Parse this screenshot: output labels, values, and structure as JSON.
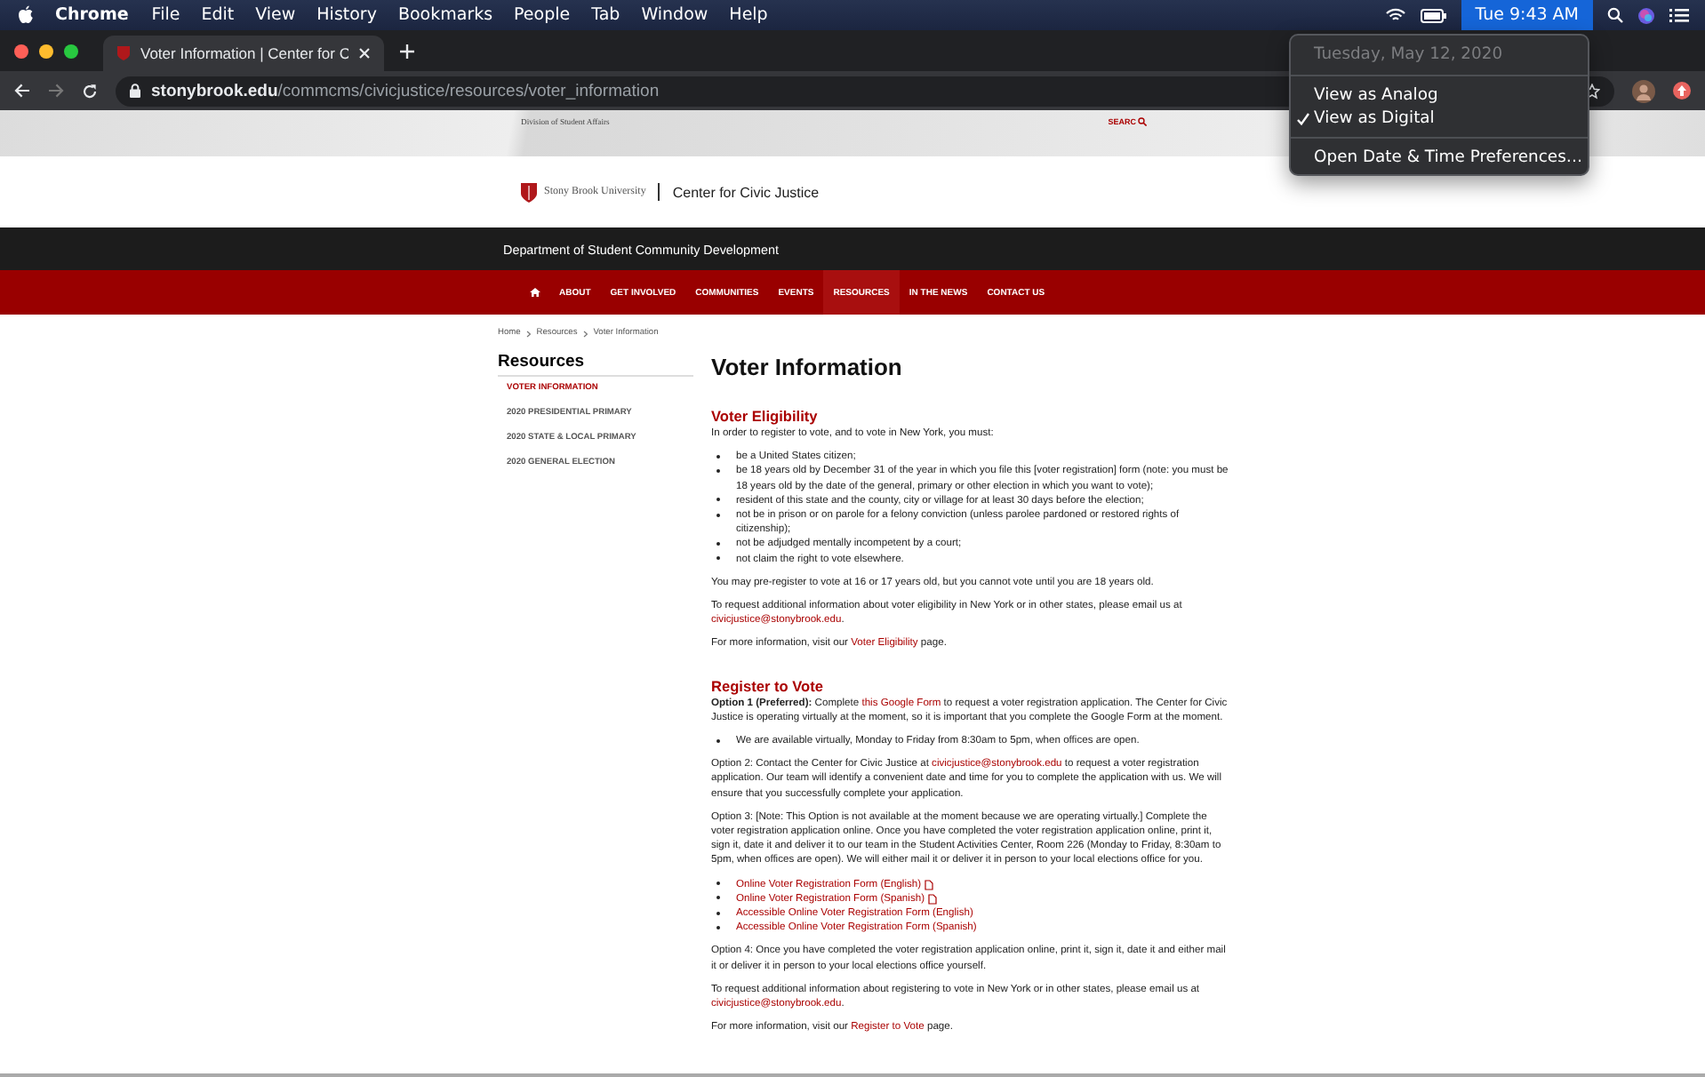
{
  "menu_bar": {
    "app": "Chrome",
    "menus": [
      "File",
      "Edit",
      "View",
      "History",
      "Bookmarks",
      "People",
      "Tab",
      "Window",
      "Help"
    ],
    "clock": {
      "text": "Tue 9:43 AM",
      "highlighted": true
    }
  },
  "clock_menu": [
    {
      "kind": "header",
      "text": "Tuesday, May 12, 2020",
      "disabled": true
    },
    {
      "kind": "separator"
    },
    {
      "kind": "item",
      "text": "View as Analog",
      "checked": false
    },
    {
      "kind": "item",
      "text": "View as Digital",
      "checked": true
    },
    {
      "kind": "separator"
    },
    {
      "kind": "item",
      "text": "Open Date & Time Preferences…",
      "checked": false
    }
  ],
  "browser": {
    "tab_title": "Voter Information | Center for C",
    "url_host": "stonybrook.edu",
    "url_path": "/commcms/civicjustice/resources/voter_information"
  },
  "site": {
    "top_strip": "Division of Student Affairs",
    "search": "SEARC",
    "university": "Stony Brook University",
    "center": "Center for Civic Justice",
    "department": "Department of Student Community Development",
    "nav": [
      {
        "label": "ABOUT",
        "selected": false
      },
      {
        "label": "GET INVOLVED",
        "selected": false
      },
      {
        "label": "COMMUNITIES",
        "selected": false
      },
      {
        "label": "EVENTS",
        "selected": false
      },
      {
        "label": "RESOURCES",
        "selected": true
      },
      {
        "label": "IN THE NEWS",
        "selected": false
      },
      {
        "label": "CONTACT US",
        "selected": false
      }
    ],
    "breadcrumb": [
      "Home",
      "Resources",
      "Voter Information"
    ]
  },
  "sidebar": {
    "title": "Resources",
    "items": [
      {
        "label": "VOTER INFORMATION",
        "selected": true
      },
      {
        "label": "2020 PRESIDENTIAL PRIMARY",
        "selected": false
      },
      {
        "label": "2020 STATE & LOCAL PRIMARY",
        "selected": false
      },
      {
        "label": "2020 GENERAL ELECTION",
        "selected": false
      }
    ]
  },
  "page_title": "Voter Information",
  "sections": [
    {
      "heading": "Voter Eligibility",
      "blocks": [
        {
          "kind": "p",
          "parts": [
            {
              "kind": "text",
              "text": "In order to register to vote, and to vote in New York, you must:"
            }
          ]
        },
        {
          "kind": "ul",
          "items": [
            {
              "parts": [
                {
                  "kind": "text",
                  "text": "be a United States citizen;"
                }
              ]
            },
            {
              "parts": [
                {
                  "kind": "text",
                  "text": "be 18 years old by December 31 of the year in which you file this [voter registration] form (note: you must be 18 years old by the date of the general, primary or other election in which you want to vote);"
                }
              ]
            },
            {
              "parts": [
                {
                  "kind": "text",
                  "text": "resident of this state and the county, city or village for at least 30 days before the election;"
                }
              ]
            },
            {
              "parts": [
                {
                  "kind": "text",
                  "text": "not be in prison or on parole for a felony conviction (unless parolee pardoned or restored rights of citizenship);"
                }
              ]
            },
            {
              "parts": [
                {
                  "kind": "text",
                  "text": "not be adjudged mentally incompetent by a court;"
                }
              ]
            },
            {
              "parts": [
                {
                  "kind": "text",
                  "text": "not claim the right to vote elsewhere."
                }
              ]
            }
          ]
        },
        {
          "kind": "p",
          "parts": [
            {
              "kind": "text",
              "text": "You may pre-register to vote at 16 or 17 years old, but you cannot vote until you are 18 years old."
            }
          ]
        },
        {
          "kind": "p",
          "parts": [
            {
              "kind": "text",
              "text": "To request additional information about voter eligibility in New York or in other states, please email us at "
            },
            {
              "kind": "link",
              "text": "civicjustice@stonybrook.edu"
            },
            {
              "kind": "text",
              "text": "."
            }
          ]
        },
        {
          "kind": "p",
          "parts": [
            {
              "kind": "text",
              "text": "For more information, visit our "
            },
            {
              "kind": "link",
              "text": "Voter Eligibility"
            },
            {
              "kind": "text",
              "text": " page."
            }
          ]
        }
      ]
    },
    {
      "heading": "Register to Vote",
      "blocks": [
        {
          "kind": "p",
          "parts": [
            {
              "kind": "bold",
              "text": "Option 1 (Preferred):"
            },
            {
              "kind": "text",
              "text": " Complete "
            },
            {
              "kind": "link",
              "text": "this Google Form"
            },
            {
              "kind": "text",
              "text": " to request a voter registration application. The Center for Civic Justice is operating virtually at the moment, so it is important that you complete the Google Form at the moment."
            }
          ]
        },
        {
          "kind": "ul",
          "items": [
            {
              "parts": [
                {
                  "kind": "text",
                  "text": "We are available virtually, Monday to Friday from 8:30am to 5pm, when offices are open."
                }
              ]
            }
          ]
        },
        {
          "kind": "p",
          "parts": [
            {
              "kind": "text",
              "text": "Option 2: Contact the Center for Civic Justice at "
            },
            {
              "kind": "link",
              "text": "civicjustice@stonybrook.edu"
            },
            {
              "kind": "text",
              "text": " to request a voter registration application. Our team will identify a convenient date and time for you to complete the application with us. We will ensure that you successfully complete your application."
            }
          ]
        },
        {
          "kind": "p",
          "parts": [
            {
              "kind": "text",
              "text": "Option 3: [Note: This Option is not available at the moment because we are operating virtually.] Complete the voter registration application online. Once you have completed the voter registration application online, print it, sign it, date it and deliver it to our team in the Student Activities Center, Room 226 (Monday to Friday, 8:30am to 5pm, when offices are open). We will either mail it or deliver it in person to your local elections office for you."
            }
          ]
        },
        {
          "kind": "ul",
          "items": [
            {
              "parts": [
                {
                  "kind": "link",
                  "text": "Online Voter Registration Form (English)"
                }
              ],
              "pdf": true
            },
            {
              "parts": [
                {
                  "kind": "link",
                  "text": "Online Voter Registration Form (Spanish)"
                }
              ],
              "pdf": true
            },
            {
              "parts": [
                {
                  "kind": "link",
                  "text": "Accessible Online Voter Registration Form (English)"
                }
              ],
              "pdf": false
            },
            {
              "parts": [
                {
                  "kind": "link",
                  "text": "Accessible Online Voter Registration Form (Spanish)"
                }
              ],
              "pdf": false
            }
          ]
        },
        {
          "kind": "p",
          "parts": [
            {
              "kind": "text",
              "text": "Option 4: Once you have completed the voter registration application online, print it, sign it, date it and either mail it or deliver it in person to your local elections office yourself."
            }
          ]
        },
        {
          "kind": "p",
          "parts": [
            {
              "kind": "text",
              "text": "To request additional information about registering to vote in New York or in other states, please email us at "
            },
            {
              "kind": "link",
              "text": "civicjustice@stonybrook.edu"
            },
            {
              "kind": "text",
              "text": "."
            }
          ]
        },
        {
          "kind": "p",
          "parts": [
            {
              "kind": "text",
              "text": "For more information, visit our "
            },
            {
              "kind": "link",
              "text": "Register to Vote"
            },
            {
              "kind": "text",
              "text": " page."
            }
          ]
        }
      ]
    }
  ]
}
